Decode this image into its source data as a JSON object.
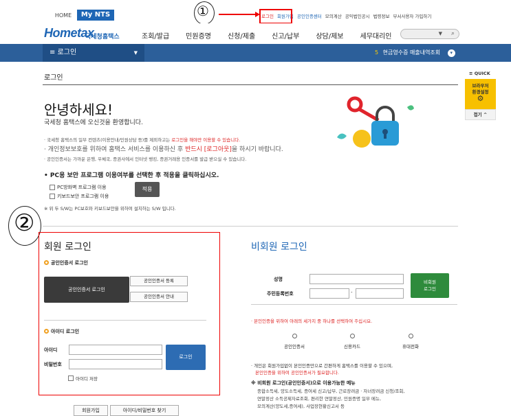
{
  "top": {
    "home": "HOME",
    "mynts": "My NTS",
    "links": [
      "로그인",
      "회원가입",
      "공인인증센터",
      "모의계산",
      "공익법인공시",
      "법령정보",
      "부서사용자 가입하기"
    ],
    "annotation_1": "①"
  },
  "header": {
    "logo": "Hometax",
    "logo_sub": "국세청홈택스",
    "nav": [
      "조회/발급",
      "민원증명",
      "신청/제출",
      "신고/납부",
      "상담/제보",
      "세무대리인"
    ]
  },
  "bluebar": {
    "menu_label": "≡ 로그인",
    "right_num": "5",
    "right_text": "현금영수증 매출내역조회"
  },
  "page_title": "로그인",
  "quick": {
    "label": "≡ QUICK",
    "box_line1": "브라우저",
    "box_line2": "환경설정",
    "top": "접기 ^"
  },
  "hello": "안녕하세요!",
  "welcome": "국세청 홈택스에 오신것을 환영합니다.",
  "bullets": {
    "line1_prefix": "· 국세청 홈택스의 일부 컨텐츠(이용안내/민원상담 등)를 제외하고는",
    "line1_red": "로그인을 해야만 이용할 수 있습니다.",
    "line2_prefix": "· 개인정보보호를 위하여 홈택스 서비스를 이용하신 후",
    "line2_red": "반드시 [로그아웃]",
    "line2_suffix": "을 하시기 바랍니다.",
    "line3": "· 공인인증서는 가까운 은행, 우체국, 증권사에서 인터넷 뱅킹, 증권거래용 인증서를 발급 받으실 수 있습니다."
  },
  "pc": {
    "title": "• PC용 보안 프로그램 이용여부를 선택한 후 적용을 클릭하십시오.",
    "opt1": "PC방화벽 프로그램 이용",
    "opt2": "키보드보안 프로그램 이용",
    "apply": "적용",
    "note": "※ 위 두 S/W는 PC보호와 키보드보안을 위하여 설치하는 S/W 입니다."
  },
  "member": {
    "annotation_2": "②",
    "title": "회원 로그인",
    "cert_section": "공인인증서 로그인",
    "cert_login": "공인인증서 로그인",
    "cert_register": "공인인증서 등록",
    "cert_guide": "공인인증서 안내",
    "id_section": "아이디 로그인",
    "id_label": "아이디",
    "pw_label": "비밀번호",
    "login_btn": "로그인",
    "save_id": "아이디 저장",
    "signup": "회원가입",
    "find": "아이디/비밀번호 찾기"
  },
  "nonmember": {
    "title": "비회원 로그인",
    "name_label": "성명",
    "rrn_label": "주민등록번호",
    "login_btn_l1": "비회원",
    "login_btn_l2": "로그인",
    "verify_note": "· 본인인증을 위하여 아래의 세가지 중 하나를 선택하여 주십시요.",
    "options": [
      "공인인증서",
      "신용카드",
      "휴대전화"
    ],
    "note_l1": "· 개인은 회원가입없이 본인인증만으로 간편하게 홈택스를 이용할 수 있으며,",
    "note_l2": "본인인증을 위하여 공인인증서가 필요합니다.",
    "svc_title": "※ 비회원 로그인(공인인증서)으로 이용가능한 메뉴",
    "svc_l1": "종합소득세, 양도소득세, 증여세 신고/납부, 근로장려금 · 자녀장려금 신청/조회,",
    "svc_l2": "연말정산 소득공제자료조회, 편리한 연말정산, 민원증명 일부 메뉴,",
    "svc_l3": "모의계산(양도세,증여세), 사업장현황신고서 등"
  }
}
